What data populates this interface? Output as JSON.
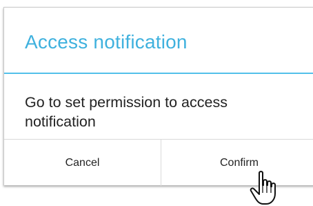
{
  "dialog": {
    "title": "Access notification",
    "message": "Go to set permission to access notification",
    "buttons": {
      "cancel_label": "Cancel",
      "confirm_label": "Confirm"
    }
  },
  "cursor": {
    "icon": "hand-pointer-icon"
  },
  "colors": {
    "accent": "#3fb1de",
    "divider": "#52c0ea",
    "text": "#222222"
  }
}
